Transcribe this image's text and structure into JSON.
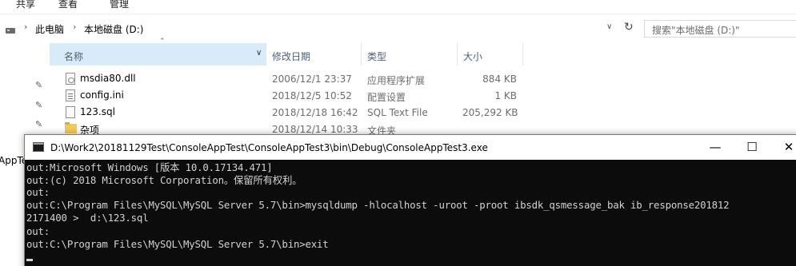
{
  "ribbon": {
    "tabs": [
      "共享",
      "查看",
      "管理"
    ]
  },
  "address": {
    "crumbs": [
      "此电脑",
      "本地磁盘 (D:)"
    ],
    "search_placeholder": "搜索\"本地磁盘 (D:)\""
  },
  "columns": [
    "名称",
    "修改日期",
    "类型",
    "大小"
  ],
  "files": [
    {
      "name": "msdia80.dll",
      "date": "2006/12/1 23:37",
      "type": "应用程序扩展",
      "size": "884 KB",
      "icon": "dll-file-icon"
    },
    {
      "name": "config.ini",
      "date": "2018/12/5 10:52",
      "type": "配置设置",
      "size": "1 KB",
      "icon": "ini-file-icon"
    },
    {
      "name": "123.sql",
      "date": "2018/12/18 16:42",
      "type": "SQL Text File",
      "size": "205,292 KB",
      "icon": "sql-file-icon"
    },
    {
      "name": "杂项",
      "date": "2018/12/14 10:33",
      "type": "文件夹",
      "size": "",
      "icon": "folder-icon"
    }
  ],
  "left_clip_text": "AppTe",
  "console": {
    "title": "D:\\Work2\\20181129Test\\ConsoleAppTest\\ConsoleAppTest3\\bin\\Debug\\ConsoleAppTest3.exe",
    "buttons": {
      "minimize": "—",
      "maximize": "☐",
      "close": "✕"
    },
    "lines": [
      "out:Microsoft Windows [版本 10.0.17134.471]",
      "out:(c) 2018 Microsoft Corporation。保留所有权利。",
      "out:",
      "out:C:\\Program Files\\MySQL\\MySQL Server 5.7\\bin>mysqldump -hlocalhost -uroot -proot ibsdk_qsmessage_bak ib_response201812",
      "2171400 >  d:\\123.sql",
      "out:",
      "out:C:\\Program Files\\MySQL\\MySQL Server 5.7\\bin>exit"
    ]
  }
}
